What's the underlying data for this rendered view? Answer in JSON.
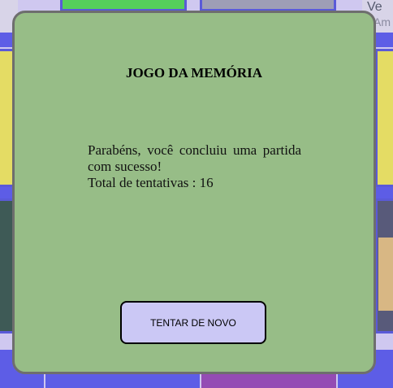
{
  "background": {
    "peek_text_line1": "Ve",
    "peek_text_line2": "Am"
  },
  "modal": {
    "title": "JOGO DA MEMÓRIA",
    "message_line1": "Parabéns, você concluiu uma partida com sucesso!",
    "attempts_label": "Total de tentativas : 16",
    "retry_label": "TENTAR DE NOVO"
  },
  "colors": {
    "modal_bg": "#97bd87",
    "button_bg": "#cbc8f5",
    "board_blue": "#5d5de6"
  }
}
